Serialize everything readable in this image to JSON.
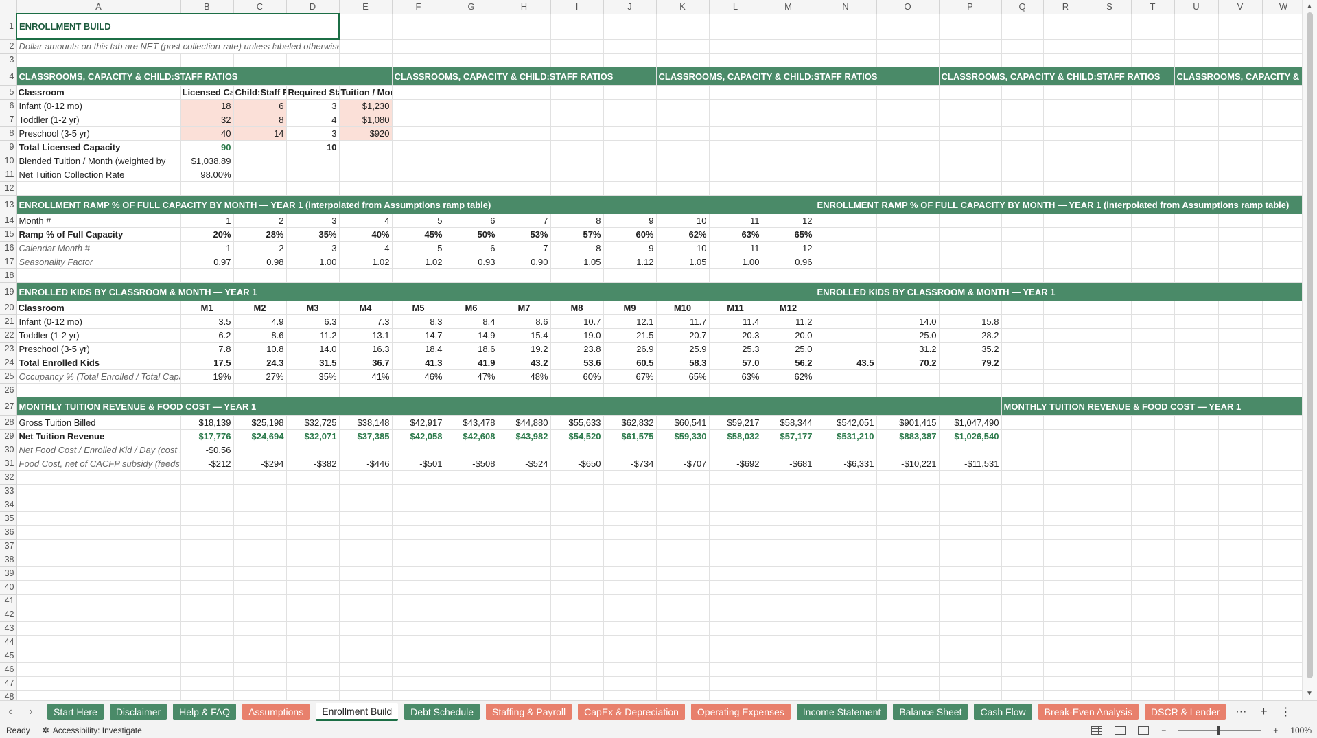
{
  "columns": [
    "A",
    "B",
    "C",
    "D",
    "E",
    "F",
    "G",
    "H",
    "I",
    "J",
    "K",
    "L",
    "M",
    "N",
    "O",
    "P",
    "Q",
    "R",
    "S",
    "T",
    "U",
    "V",
    "W"
  ],
  "rows": {
    "r1": {
      "A": "ENROLLMENT BUILD"
    },
    "r2": {
      "A": "Dollar amounts on this tab are NET (post collection-rate) unless labeled otherwise. Child:"
    },
    "r4": {
      "A": "CLASSROOMS, CAPACITY & CHILD:STAFF RATIOS"
    },
    "r5": {
      "A": "Classroom",
      "B": "Licensed Capa",
      "C": "Child:Staff Ra",
      "D": "Required Staf",
      "E": "Tuition / Month"
    },
    "r6": {
      "A": "Infant (0-12 mo)",
      "B": "18",
      "C": "6",
      "D": "3",
      "E": "$1,230"
    },
    "r7": {
      "A": "Toddler (1-2 yr)",
      "B": "32",
      "C": "8",
      "D": "4",
      "E": "$1,080"
    },
    "r8": {
      "A": "Preschool (3-5 yr)",
      "B": "40",
      "C": "14",
      "D": "3",
      "E": "$920"
    },
    "r9": {
      "A": "Total Licensed Capacity",
      "B": "90",
      "D": "10"
    },
    "r10": {
      "A": "Blended Tuition / Month (weighted by",
      "B": "$1,038.89"
    },
    "r11": {
      "A": "Net Tuition Collection Rate",
      "B": "98.00%"
    },
    "r13": {
      "A": "ENROLLMENT RAMP % OF FULL CAPACITY BY MONTH — YEAR 1 (interpolated from Assumptions ramp table)"
    },
    "r14": {
      "A": "Month #",
      "B": "1",
      "C": "2",
      "D": "3",
      "E": "4",
      "F": "5",
      "G": "6",
      "H": "7",
      "I": "8",
      "J": "9",
      "K": "10",
      "L": "11",
      "M": "12"
    },
    "r15": {
      "A": "Ramp % of Full Capacity",
      "B": "20%",
      "C": "28%",
      "D": "35%",
      "E": "40%",
      "F": "45%",
      "G": "50%",
      "H": "53%",
      "I": "57%",
      "J": "60%",
      "K": "62%",
      "L": "63%",
      "M": "65%"
    },
    "r16": {
      "A": "Calendar Month #",
      "B": "1",
      "C": "2",
      "D": "3",
      "E": "4",
      "F": "5",
      "G": "6",
      "H": "7",
      "I": "8",
      "J": "9",
      "K": "10",
      "L": "11",
      "M": "12"
    },
    "r17": {
      "A": "Seasonality Factor",
      "B": "0.97",
      "C": "0.98",
      "D": "1.00",
      "E": "1.02",
      "F": "1.02",
      "G": "0.93",
      "H": "0.90",
      "I": "1.05",
      "J": "1.12",
      "K": "1.05",
      "L": "1.00",
      "M": "0.96"
    },
    "r19": {
      "A": "ENROLLED KIDS BY CLASSROOM & MONTH — YEAR 1"
    },
    "r20": {
      "A": "Classroom",
      "B": "M1",
      "C": "M2",
      "D": "M3",
      "E": "M4",
      "F": "M5",
      "G": "M6",
      "H": "M7",
      "I": "M8",
      "J": "M9",
      "K": "M10",
      "L": "M11",
      "M": "M12"
    },
    "r21": {
      "A": "Infant (0-12 mo)",
      "B": "3.5",
      "C": "4.9",
      "D": "6.3",
      "E": "7.3",
      "F": "8.3",
      "G": "8.4",
      "H": "8.6",
      "I": "10.7",
      "J": "12.1",
      "K": "11.7",
      "L": "11.4",
      "M": "11.2",
      "O": "14.0",
      "P": "15.8"
    },
    "r22": {
      "A": "Toddler (1-2 yr)",
      "B": "6.2",
      "C": "8.6",
      "D": "11.2",
      "E": "13.1",
      "F": "14.7",
      "G": "14.9",
      "H": "15.4",
      "I": "19.0",
      "J": "21.5",
      "K": "20.7",
      "L": "20.3",
      "M": "20.0",
      "O": "25.0",
      "P": "28.2"
    },
    "r23": {
      "A": "Preschool (3-5 yr)",
      "B": "7.8",
      "C": "10.8",
      "D": "14.0",
      "E": "16.3",
      "F": "18.4",
      "G": "18.6",
      "H": "19.2",
      "I": "23.8",
      "J": "26.9",
      "K": "25.9",
      "L": "25.3",
      "M": "25.0",
      "O": "31.2",
      "P": "35.2"
    },
    "r24": {
      "A": "Total Enrolled Kids",
      "B": "17.5",
      "C": "24.3",
      "D": "31.5",
      "E": "36.7",
      "F": "41.3",
      "G": "41.9",
      "H": "43.2",
      "I": "53.6",
      "J": "60.5",
      "K": "58.3",
      "L": "57.0",
      "M": "56.2",
      "N": "43.5",
      "O": "70.2",
      "P": "79.2"
    },
    "r25": {
      "A": "Occupancy % (Total Enrolled / Total Capacity",
      "B": "19%",
      "C": "27%",
      "D": "35%",
      "E": "41%",
      "F": "46%",
      "G": "47%",
      "H": "48%",
      "I": "60%",
      "J": "67%",
      "K": "65%",
      "L": "63%",
      "M": "62%"
    },
    "r27": {
      "A": "MONTHLY TUITION REVENUE & FOOD COST — YEAR 1"
    },
    "r28": {
      "A": "Gross Tuition Billed",
      "B": "$18,139",
      "C": "$25,198",
      "D": "$32,725",
      "E": "$38,148",
      "F": "$42,917",
      "G": "$43,478",
      "H": "$44,880",
      "I": "$55,633",
      "J": "$62,832",
      "K": "$60,541",
      "L": "$59,217",
      "M": "$58,344",
      "N": "$542,051",
      "O": "$901,415",
      "P": "$1,047,490"
    },
    "r29": {
      "A": "Net Tuition Revenue",
      "B": "$17,776",
      "C": "$24,694",
      "D": "$32,071",
      "E": "$37,385",
      "F": "$42,058",
      "G": "$42,608",
      "H": "$43,982",
      "I": "$54,520",
      "J": "$61,575",
      "K": "$59,330",
      "L": "$58,032",
      "M": "$57,177",
      "N": "$531,210",
      "O": "$883,387",
      "P": "$1,026,540"
    },
    "r30": {
      "A": "Net Food Cost / Enrolled Kid / Day (cost less",
      "B": "-$0.56"
    },
    "r31": {
      "A": "Food Cost, net of CACFP subsidy (feeds COG",
      "B": "-$212",
      "C": "-$294",
      "D": "-$382",
      "E": "-$446",
      "F": "-$501",
      "G": "-$508",
      "H": "-$524",
      "I": "-$650",
      "J": "-$734",
      "K": "-$707",
      "L": "-$692",
      "M": "-$681",
      "N": "-$6,331",
      "O": "-$10,221",
      "P": "-$11,531"
    }
  },
  "tabs": [
    {
      "label": "Start Here",
      "color": "green"
    },
    {
      "label": "Disclaimer",
      "color": "green"
    },
    {
      "label": "Help & FAQ",
      "color": "green"
    },
    {
      "label": "Assumptions",
      "color": "coral"
    },
    {
      "label": "Enrollment Build",
      "color": "active"
    },
    {
      "label": "Debt Schedule",
      "color": "green"
    },
    {
      "label": "Staffing & Payroll",
      "color": "coral"
    },
    {
      "label": "CapEx & Depreciation",
      "color": "coral"
    },
    {
      "label": "Operating Expenses",
      "color": "coral"
    },
    {
      "label": "Income Statement",
      "color": "green"
    },
    {
      "label": "Balance Sheet",
      "color": "green"
    },
    {
      "label": "Cash Flow",
      "color": "green"
    },
    {
      "label": "Break-Even Analysis",
      "color": "coral"
    },
    {
      "label": "DSCR & Lender",
      "color": "coral"
    }
  ],
  "status": {
    "ready": "Ready",
    "accessibility": "Accessibility: Investigate",
    "zoom": "100%"
  },
  "icons": {
    "prev": "chevron-left-icon",
    "next": "chevron-right-icon",
    "more": "ellipsis-icon",
    "add": "plus-icon",
    "options": "vertical-ellipsis-icon"
  }
}
